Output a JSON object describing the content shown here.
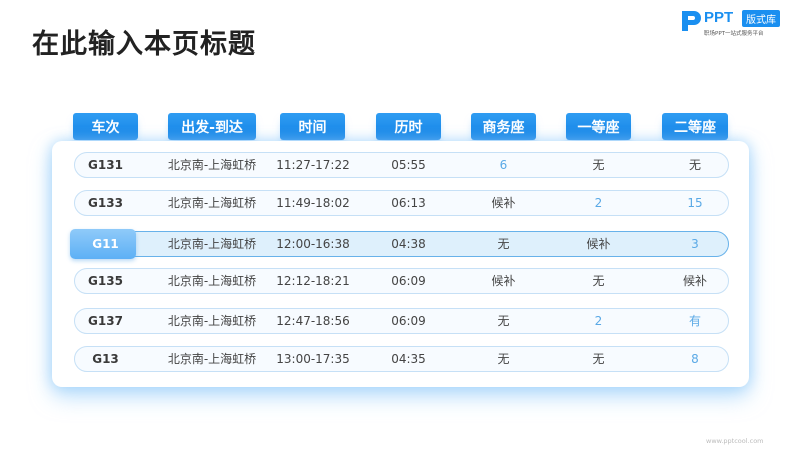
{
  "title": "在此输入本页标题",
  "logo": {
    "text": "PPT",
    "badge": "版式库",
    "sub": "职场PPT一站式服务平台"
  },
  "columns": [
    "车次",
    "出发-到达",
    "时间",
    "历时",
    "商务座",
    "一等座",
    "二等座"
  ],
  "rows": [
    {
      "train": "G131",
      "route": "北京南-上海虹桥",
      "time": "11:27-17:22",
      "duration": "05:55",
      "business": "6",
      "first": "无",
      "second": "无"
    },
    {
      "train": "G133",
      "route": "北京南-上海虹桥",
      "time": "11:49-18:02",
      "duration": "06:13",
      "business": "候补",
      "first": "2",
      "second": "15"
    },
    {
      "train": "G11",
      "route": "北京南-上海虹桥",
      "time": "12:00-16:38",
      "duration": "04:38",
      "business": "无",
      "first": "候补",
      "second": "3"
    },
    {
      "train": "G135",
      "route": "北京南-上海虹桥",
      "time": "12:12-18:21",
      "duration": "06:09",
      "business": "候补",
      "first": "无",
      "second": "候补"
    },
    {
      "train": "G137",
      "route": "北京南-上海虹桥",
      "time": "12:47-18:56",
      "duration": "06:09",
      "business": "无",
      "first": "2",
      "second": "有"
    },
    {
      "train": "G13",
      "route": "北京南-上海虹桥",
      "time": "13:00-17:35",
      "duration": "04:35",
      "business": "无",
      "first": "无",
      "second": "8"
    }
  ],
  "highlight_row": 2,
  "colors": {
    "accent": "#1283e6",
    "number": "#5aa9e6"
  },
  "footer": "www.pptcool.com"
}
